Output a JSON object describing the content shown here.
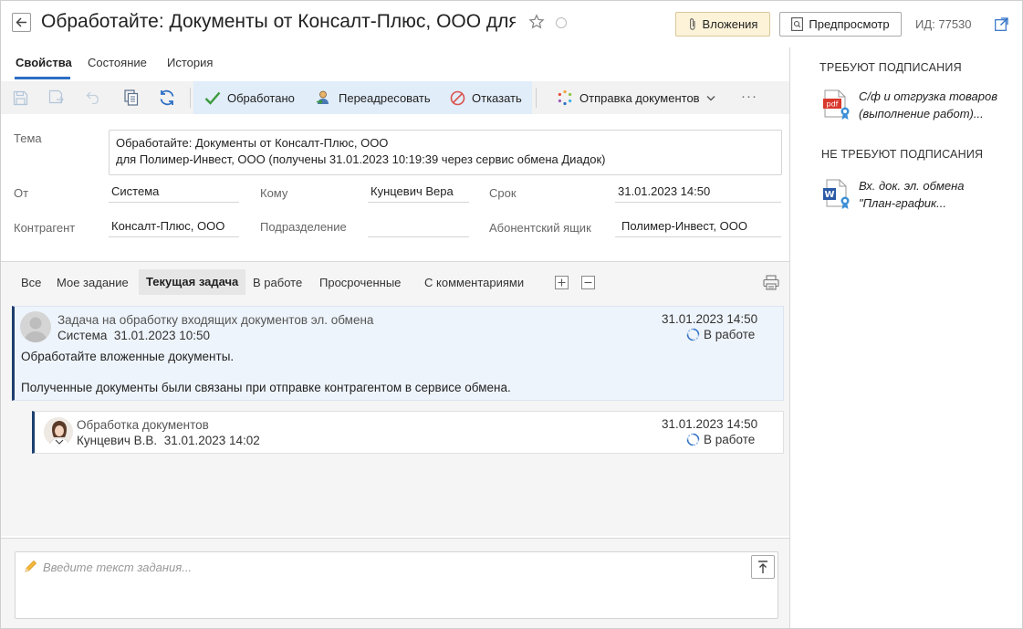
{
  "header": {
    "title": "Обработайте: Документы от Консалт-Плюс, ООО для ...",
    "attachments_label": "Вложения",
    "preview_label": "Предпросмотр",
    "id_label": "ИД: 77530"
  },
  "tabs": [
    "Свойства",
    "Состояние",
    "История"
  ],
  "toolbar": {
    "processed": "Обработано",
    "readdress": "Переадресовать",
    "refuse": "Отказать",
    "send_docs": "Отправка документов",
    "more": "···"
  },
  "form": {
    "subject_label": "Тема",
    "subject_line1": "Обработайте: Документы от Консалт-Плюс, ООО",
    "subject_line2": "для Полимер-Инвест, ООО (получены 31.01.2023 10:19:39 через сервис обмена Диадок)",
    "from_label": "От",
    "from_value": "Система",
    "to_label": "Кому",
    "to_value": "Кунцевич Вера",
    "deadline_label": "Срок",
    "deadline_value": "31.01.2023 14:50",
    "counterparty_label": "Контрагент",
    "counterparty_value": "Консалт-Плюс, ООО",
    "department_label": "Подразделение",
    "department_value": "",
    "mailbox_label": "Абонентский ящик",
    "mailbox_value": "Полимер-Инвест, ООО"
  },
  "filters": {
    "all": "Все",
    "my_task": "Мое задание",
    "current_task": "Текущая задача",
    "in_progress": "В работе",
    "overdue": "Просроченные",
    "with_comments": "С комментариями"
  },
  "tasks": {
    "main": {
      "title": "Задача на обработку входящих документов эл. обмена",
      "author": "Система",
      "created": "31.01.2023 10:50",
      "deadline": "31.01.2023 14:50",
      "status": "В работе",
      "body_line1": "Обработайте вложенные документы.",
      "body_line2": "Полученные документы были связаны при отправке контрагентом в сервисе обмена."
    },
    "sub": {
      "title": "Обработка документов",
      "author": "Кунцевич В.В.",
      "created": "31.01.2023 14:02",
      "deadline": "31.01.2023 14:50",
      "status": "В работе"
    }
  },
  "input": {
    "placeholder": "Введите текст задания..."
  },
  "right_pane": {
    "need_sign_heading": "ТРЕБУЮТ ПОДПИСАНИЯ",
    "need_sign_item_line1": "С/ф и отгрузка товаров",
    "need_sign_item_line2": "(выполнение работ)...",
    "no_sign_heading": "НЕ ТРЕБУЮТ ПОДПИСАНИЯ",
    "no_sign_item_line1": "Вх. док. эл. обмена",
    "no_sign_item_line2": "\"План-график..."
  },
  "icons": {
    "pdf_label": "pdf",
    "word_label": "W"
  },
  "colors": {
    "accent_blue": "#2d6fc4",
    "toolbar_highlight": "#e1edf9",
    "attach_button_bg": "#fdf3d8",
    "task_border": "#1c3f6e"
  }
}
